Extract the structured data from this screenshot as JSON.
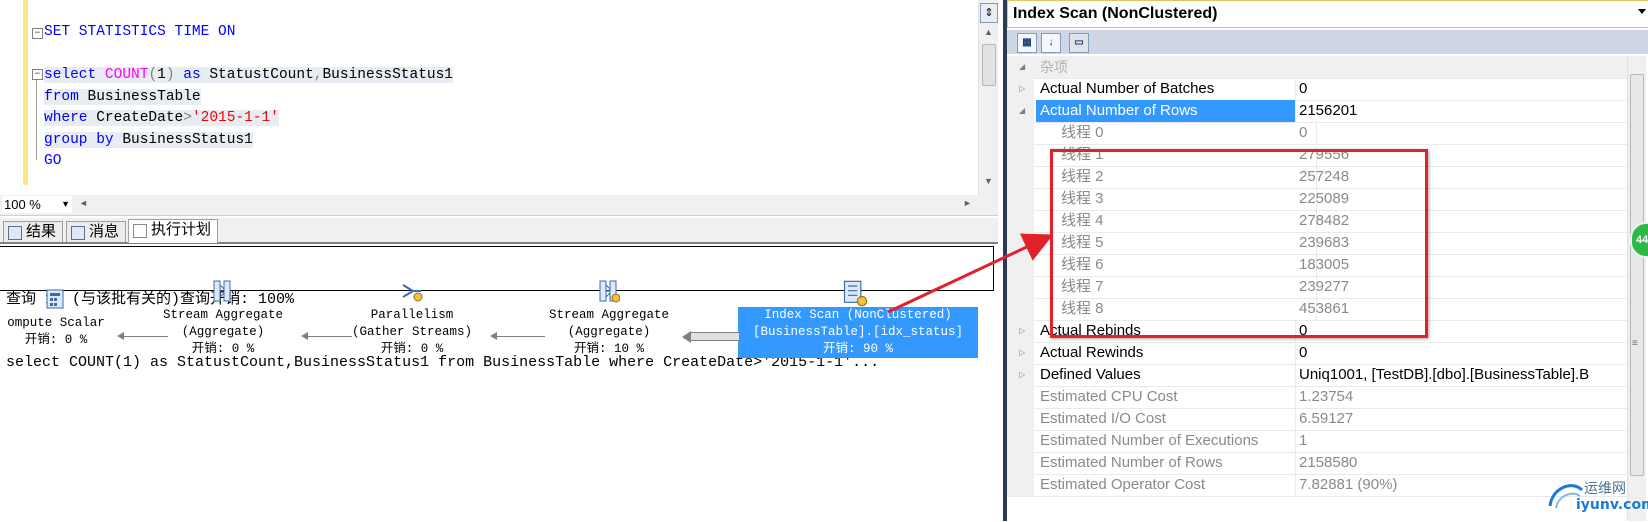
{
  "editor": {
    "lines": [
      {
        "parts": [
          {
            "t": "SET STATISTICS TIME ON",
            "c": "kw"
          }
        ]
      },
      {
        "parts": []
      },
      {
        "parts": [
          {
            "t": "select ",
            "c": "kw"
          },
          {
            "t": "COUNT",
            "c": "fn"
          },
          {
            "t": "(",
            "c": "op"
          },
          {
            "t": "1",
            "c": "txt"
          },
          {
            "t": ") ",
            "c": "op"
          },
          {
            "t": "as ",
            "c": "kw"
          },
          {
            "t": "StatustCount",
            "c": "txt"
          },
          {
            "t": ",",
            "c": "op"
          },
          {
            "t": "BusinessStatus1",
            "c": "txt"
          }
        ]
      },
      {
        "parts": [
          {
            "t": "from ",
            "c": "kw"
          },
          {
            "t": "BusinessTable",
            "c": "txt"
          }
        ]
      },
      {
        "parts": [
          {
            "t": "where ",
            "c": "kw"
          },
          {
            "t": "CreateDate",
            "c": "txt"
          },
          {
            "t": ">",
            "c": "op"
          },
          {
            "t": "'2015-1-1'",
            "c": "str"
          }
        ]
      },
      {
        "parts": [
          {
            "t": "group by ",
            "c": "kw"
          },
          {
            "t": "BusinessStatus1",
            "c": "txt"
          }
        ]
      },
      {
        "parts": [
          {
            "t": "GO",
            "c": "kw"
          }
        ]
      }
    ],
    "zoom": "100 %"
  },
  "tabs": [
    {
      "label": "结果",
      "icon": "grid-icon"
    },
    {
      "label": "消息",
      "icon": "message-icon"
    },
    {
      "label": "执行计划",
      "icon": "execution-plan-icon",
      "active": true
    }
  ],
  "plan": {
    "header_line1": "查询 1: (与该批有关的)查询开销: 100%",
    "header_line2": "select COUNT(1) as StatustCount,BusinessStatus1 from BusinessTable where CreateDate>'2015-1-1'...",
    "nodes": [
      {
        "name": "compute-scalar",
        "line1": "ompute Scalar",
        "line2": "",
        "cost": "开销: 0 %",
        "icon": "compute-scalar-icon"
      },
      {
        "name": "stream-aggregate-1",
        "line1": "Stream Aggregate",
        "line2": "(Aggregate)",
        "cost": "开销: 0 %",
        "icon": "stream-aggregate-icon"
      },
      {
        "name": "parallelism",
        "line1": "Parallelism",
        "line2": "(Gather Streams)",
        "cost": "开销: 0 %",
        "icon": "parallelism-icon"
      },
      {
        "name": "stream-aggregate-2",
        "line1": "Stream Aggregate",
        "line2": "(Aggregate)",
        "cost": "开销: 10 %",
        "icon": "stream-aggregate-icon"
      },
      {
        "name": "index-scan",
        "line1": "Index Scan (NonClustered)",
        "line2": "[BusinessTable].[idx_status]",
        "cost": "开销: 90 %",
        "icon": "index-scan-icon",
        "selected": true
      }
    ]
  },
  "properties": {
    "title": "Index Scan (NonClustered)",
    "category": "杂项",
    "rows": [
      {
        "name": "Actual Number of Batches",
        "value": "0",
        "expander": "collapsed"
      },
      {
        "name": "Actual Number of Rows",
        "value": "2156201",
        "expander": "expanded",
        "selected": true
      },
      {
        "name": "线程 0",
        "value": "0",
        "sub": true
      },
      {
        "name": "线程 1",
        "value": "279556",
        "sub": true
      },
      {
        "name": "线程 2",
        "value": "257248",
        "sub": true
      },
      {
        "name": "线程 3",
        "value": "225089",
        "sub": true
      },
      {
        "name": "线程 4",
        "value": "278482",
        "sub": true
      },
      {
        "name": "线程 5",
        "value": "239683",
        "sub": true
      },
      {
        "name": "线程 6",
        "value": "183005",
        "sub": true
      },
      {
        "name": "线程 7",
        "value": "239277",
        "sub": true
      },
      {
        "name": "线程 8",
        "value": "453861",
        "sub": true
      },
      {
        "name": "Actual Rebinds",
        "value": "0",
        "expander": "collapsed"
      },
      {
        "name": "Actual Rewinds",
        "value": "0",
        "expander": "collapsed"
      },
      {
        "name": "Defined Values",
        "value": "Uniq1001, [TestDB].[dbo].[BusinessTable].B",
        "expander": "collapsed"
      },
      {
        "name": "Estimated CPU Cost",
        "value": "1.23754",
        "dim": true
      },
      {
        "name": "Estimated I/O Cost",
        "value": "6.59127",
        "dim": true
      },
      {
        "name": "Estimated Number of Executions",
        "value": "1",
        "dim": true
      },
      {
        "name": "Estimated Number of Rows",
        "value": "2158580",
        "dim": true
      },
      {
        "name": "Estimated Operator Cost",
        "value": "7.82881 (90%)",
        "dim": true
      }
    ]
  },
  "badge": {
    "text": "44"
  },
  "watermark": {
    "line1": "运维网",
    "line2": "iyunv.com"
  },
  "colors": {
    "annotation_red": "#e0232b",
    "selection_blue": "#3399ff"
  }
}
